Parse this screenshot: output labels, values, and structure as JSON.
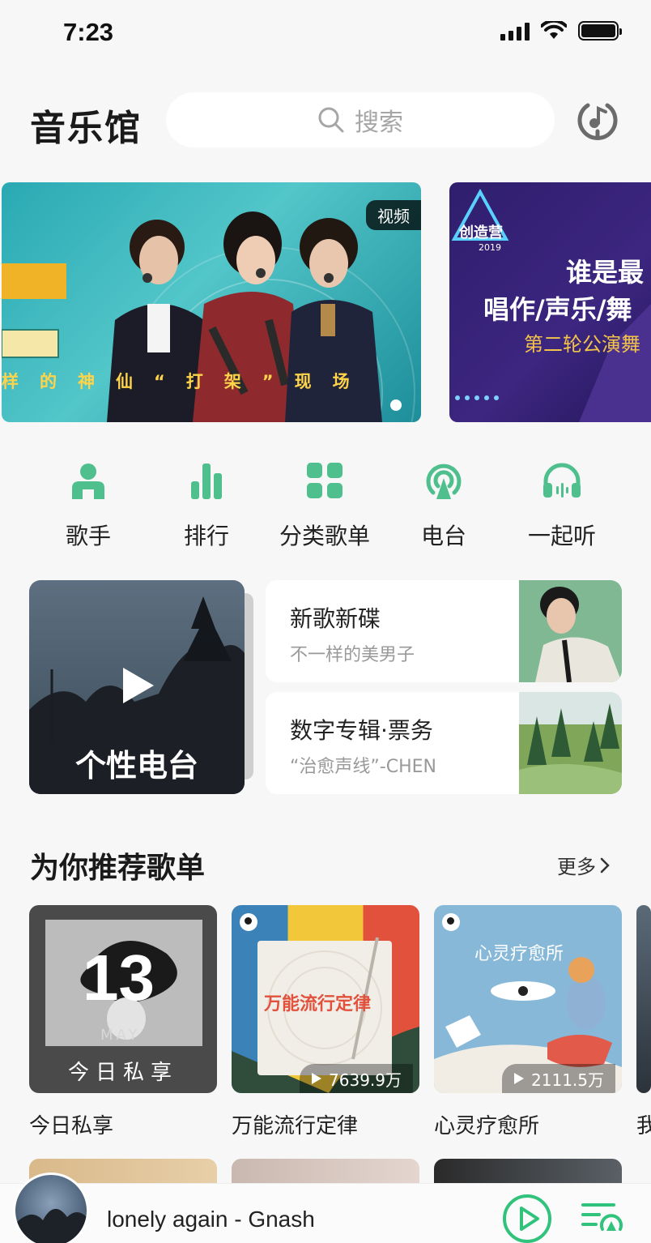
{
  "status_bar": {
    "time": "7:23"
  },
  "header": {
    "title": "音乐馆",
    "search_placeholder": "搜索"
  },
  "banners": [
    {
      "tag": "视频",
      "caption": "样的神仙“打架”现场"
    },
    {
      "line1": "谁是最",
      "line2": "唱作/声乐/舞",
      "line3": "第二轮公演舞",
      "logo_text": "创造营",
      "logo_year": "2019"
    }
  ],
  "quick_nav": [
    {
      "label": "歌手",
      "icon": "singer-icon"
    },
    {
      "label": "排行",
      "icon": "chart-icon"
    },
    {
      "label": "分类歌单",
      "icon": "category-icon"
    },
    {
      "label": "电台",
      "icon": "radio-icon"
    },
    {
      "label": "一起听",
      "icon": "listen-together-icon"
    }
  ],
  "feature": {
    "radio_title": "个性电台",
    "cards": [
      {
        "title": "新歌新碟",
        "subtitle": "不一样的美男子"
      },
      {
        "title": "数字专辑·票务",
        "subtitle": "“治愈声线”-CHEN"
      }
    ]
  },
  "recommend": {
    "title": "为你推荐歌单",
    "more": "更多",
    "playlists": [
      {
        "name": "今日私享",
        "cover_number": "13",
        "cover_month": "MAY",
        "cover_label": "今日私享"
      },
      {
        "name": "万能流行定律",
        "cover_text": "万能流行定律",
        "plays": "7639.9万"
      },
      {
        "name": "心灵疗愈所",
        "cover_text": "心灵疗愈所",
        "plays": "2111.5万"
      },
      {
        "name": "我"
      }
    ]
  },
  "player": {
    "track": "lonely again - Gnash"
  },
  "colors": {
    "accent": "#31c27c",
    "icon_green": "#4fc08d"
  }
}
